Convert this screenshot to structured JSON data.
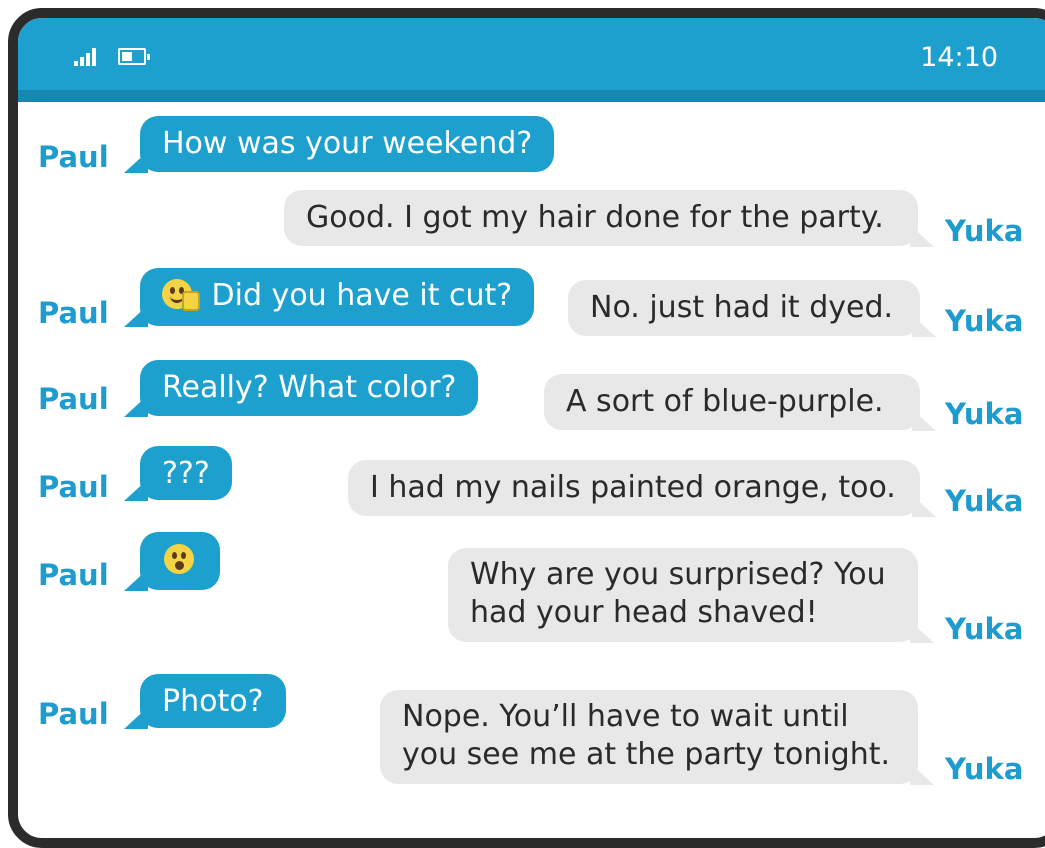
{
  "status": {
    "time": "14:10"
  },
  "colors": {
    "bar": "#1ea0cf",
    "paul_bubble": "#1ea0cf",
    "yuka_bubble": "#e8e8e8",
    "name": "#1e9bcf"
  },
  "names": {
    "paul": "Paul",
    "yuka": "Yuka"
  },
  "messages": {
    "m1": "How was your weekend?",
    "m2": "Good. I got my hair done for the party.",
    "m3": "Did you have it cut?",
    "m4": "No. just had it dyed.",
    "m5": "Really? What color?",
    "m6": "A sort of blue-purple.",
    "m7": "???",
    "m8": "I had my nails painted orange, too.",
    "m9": "",
    "m10_l1": "Why are you surprised? You",
    "m10_l2": "had your head shaved!",
    "m11": "Photo?",
    "m12_l1": "Nope. You’ll have to wait until",
    "m12_l2": "you see me at the party tonight."
  },
  "icons": {
    "m3": "thumbs-up-emoji-icon",
    "m9": "surprised-emoji-icon"
  }
}
